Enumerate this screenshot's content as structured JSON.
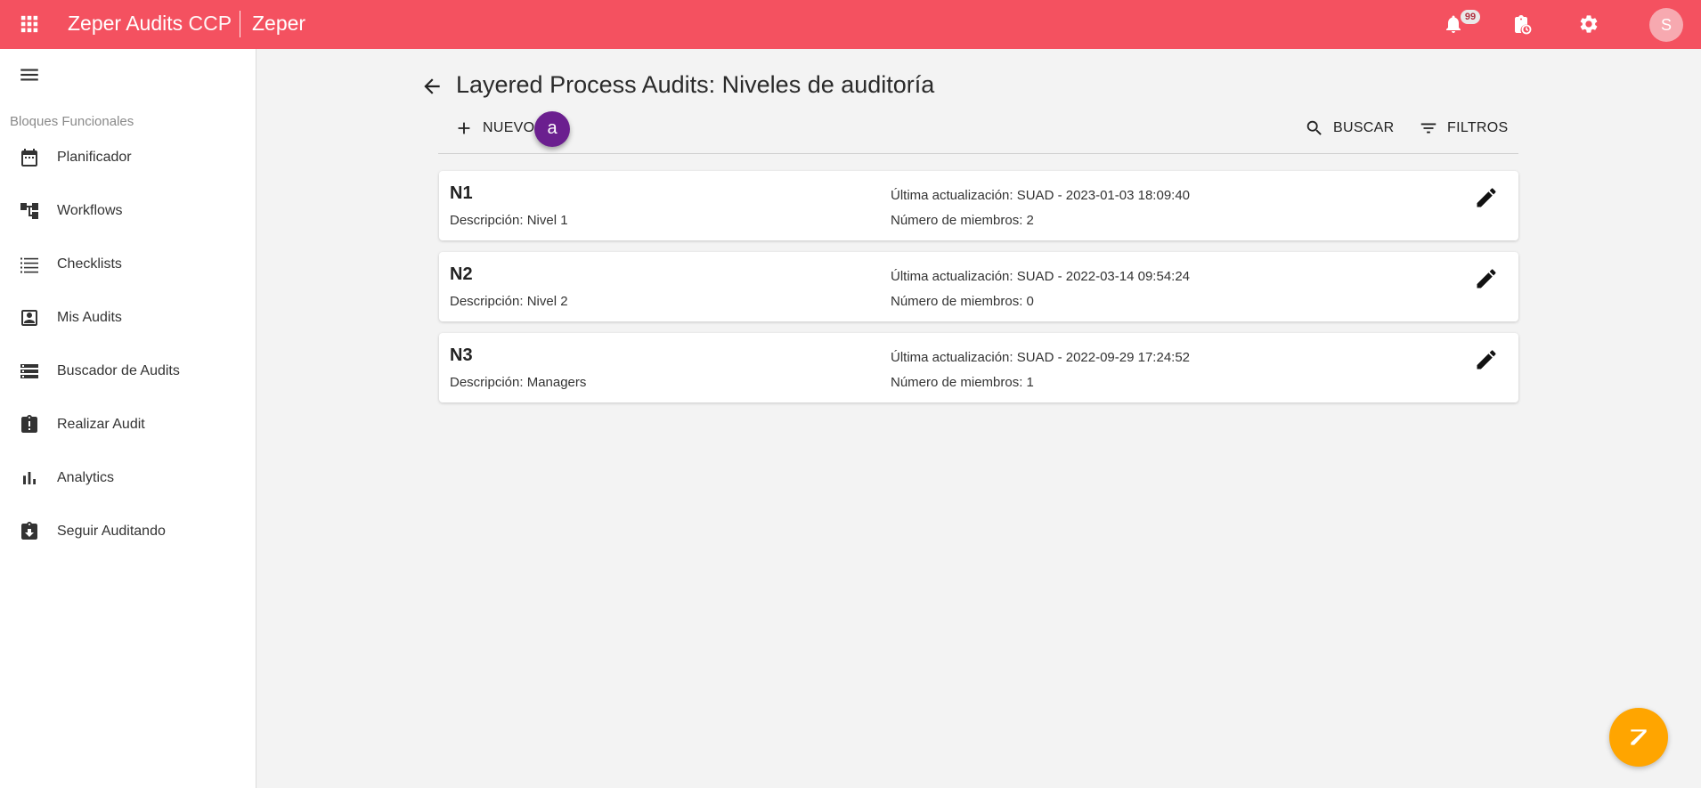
{
  "topbar": {
    "brand_bold": "Zeper Audits",
    "brand_light": " CCP",
    "tenant": "Zeper",
    "notification_count": "99",
    "avatar_initial": "S"
  },
  "sidebar": {
    "section_title": "Bloques Funcionales",
    "items": [
      {
        "label": "Planificador",
        "icon": "calendar-icon"
      },
      {
        "label": "Workflows",
        "icon": "workflow-icon"
      },
      {
        "label": "Checklists",
        "icon": "checklist-icon"
      },
      {
        "label": "Mis Audits",
        "icon": "account-box-icon"
      },
      {
        "label": "Buscador de Audits",
        "icon": "storage-list-icon"
      },
      {
        "label": "Realizar Audit",
        "icon": "clipboard-alert-icon"
      },
      {
        "label": "Analytics",
        "icon": "bar-chart-icon"
      },
      {
        "label": "Seguir Auditando",
        "icon": "clipboard-download-icon"
      }
    ]
  },
  "main": {
    "title": "Layered Process Audits: Niveles de auditoría",
    "toolbar": {
      "new_label": "NUEVO",
      "search_label": "BUSCAR",
      "filters_label": "FILTROS"
    },
    "step_marker": "a",
    "levels": [
      {
        "code": "N1",
        "description": "Descripción: Nivel 1",
        "updated": "Última actualización: SUAD - 2023-01-03 18:09:40",
        "members": "Número de miembros: 2"
      },
      {
        "code": "N2",
        "description": "Descripción: Nivel 2",
        "updated": "Última actualización: SUAD - 2022-03-14 09:54:24",
        "members": "Número de miembros: 0"
      },
      {
        "code": "N3",
        "description": "Descripción: Managers",
        "updated": "Última actualización: SUAD - 2022-09-29 17:24:52",
        "members": "Número de miembros: 1"
      }
    ]
  },
  "colors": {
    "topbar": "#f45160",
    "step_marker": "#6b1f8f",
    "fab": "#ffa500"
  }
}
